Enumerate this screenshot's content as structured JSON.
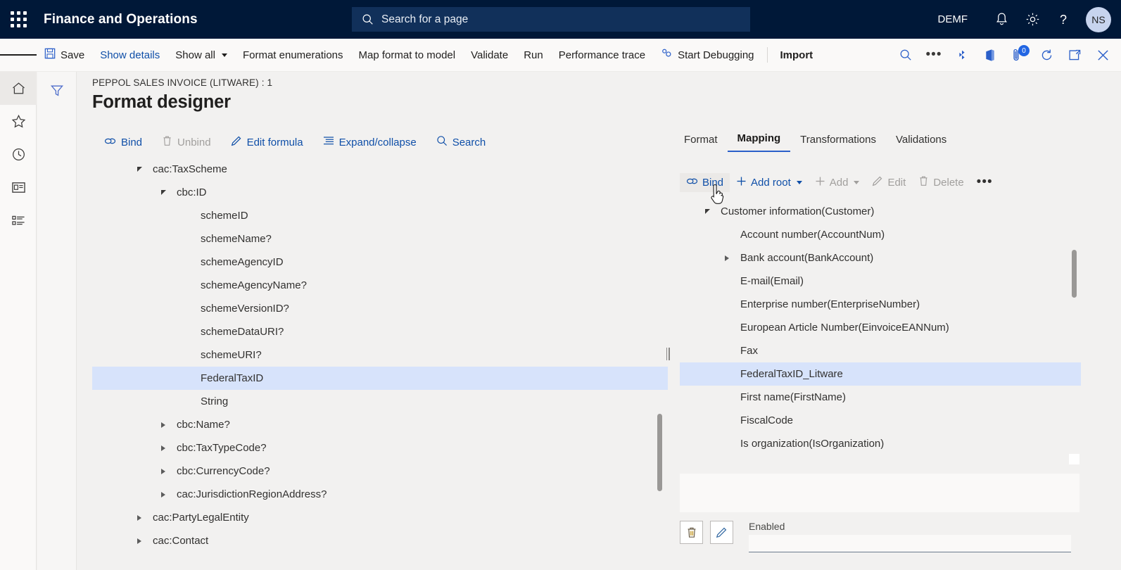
{
  "navbar": {
    "waffle_title": "app-launcher",
    "brand": "Finance and Operations",
    "search_placeholder": "Search for a page",
    "company": "DEMF",
    "notifications_icon": "bell-icon",
    "settings_icon": "gear-icon",
    "help_icon": "question-icon",
    "avatar_initials": "NS"
  },
  "commandbar": {
    "save": "Save",
    "show_details": "Show details",
    "show_all": "Show all",
    "format_enumerations": "Format enumerations",
    "map_format_to_model": "Map format to model",
    "validate": "Validate",
    "run": "Run",
    "performance_trace": "Performance trace",
    "start_debugging": "Start Debugging",
    "import": "Import",
    "icons": {
      "search": "search-icon",
      "overflow": "more-options-icon",
      "share": "share-icon",
      "office": "office-app-icon",
      "attachments": "attachments-icon",
      "attachments_count": "0",
      "refresh": "refresh-icon",
      "popout": "open-in-new-window-icon",
      "close": "close-icon"
    }
  },
  "rail": {
    "items": [
      {
        "name": "home-icon",
        "label": "Home"
      },
      {
        "name": "favorites-star-icon",
        "label": "Favorites"
      },
      {
        "name": "recent-clock-icon",
        "label": "Recent"
      },
      {
        "name": "workspaces-icon",
        "label": "Workspaces"
      },
      {
        "name": "modules-list-icon",
        "label": "Modules"
      }
    ]
  },
  "filter_panel": {
    "icon": "filter-funnel-icon"
  },
  "page": {
    "breadcrumb": "PEPPOL SALES INVOICE (LITWARE) : 1",
    "title": "Format designer"
  },
  "left_toolbar": [
    {
      "label": "Bind",
      "icon": "bind-link-icon",
      "disabled": false
    },
    {
      "label": "Unbind",
      "icon": "trash-icon",
      "disabled": true
    },
    {
      "label": "Edit formula",
      "icon": "pencil-icon",
      "disabled": false
    },
    {
      "label": "Expand/collapse",
      "icon": "list-expand-icon",
      "disabled": false
    },
    {
      "label": "Search",
      "icon": "search-icon",
      "disabled": false
    }
  ],
  "left_tree": [
    {
      "label": "cac:TaxScheme",
      "indent": 1,
      "toggle": "open",
      "selected": false
    },
    {
      "label": "cbc:ID",
      "indent": 2,
      "toggle": "open",
      "selected": false
    },
    {
      "label": "schemeID",
      "indent": 3,
      "toggle": "none",
      "selected": false
    },
    {
      "label": "schemeName?",
      "indent": 3,
      "toggle": "none",
      "selected": false
    },
    {
      "label": "schemeAgencyID",
      "indent": 3,
      "toggle": "none",
      "selected": false
    },
    {
      "label": "schemeAgencyName?",
      "indent": 3,
      "toggle": "none",
      "selected": false
    },
    {
      "label": "schemeVersionID?",
      "indent": 3,
      "toggle": "none",
      "selected": false
    },
    {
      "label": "schemeDataURI?",
      "indent": 3,
      "toggle": "none",
      "selected": false
    },
    {
      "label": "schemeURI?",
      "indent": 3,
      "toggle": "none",
      "selected": false
    },
    {
      "label": "FederalTaxID",
      "indent": 3,
      "toggle": "none",
      "selected": true
    },
    {
      "label": "String",
      "indent": 3,
      "toggle": "none",
      "selected": false
    },
    {
      "label": "cbc:Name?",
      "indent": 2,
      "toggle": "closed",
      "selected": false
    },
    {
      "label": "cbc:TaxTypeCode?",
      "indent": 2,
      "toggle": "closed",
      "selected": false
    },
    {
      "label": "cbc:CurrencyCode?",
      "indent": 2,
      "toggle": "closed",
      "selected": false
    },
    {
      "label": "cac:JurisdictionRegionAddress?",
      "indent": 2,
      "toggle": "closed",
      "selected": false
    },
    {
      "label": "cac:PartyLegalEntity",
      "indent": 1,
      "toggle": "closed",
      "selected": false
    },
    {
      "label": "cac:Contact",
      "indent": 1,
      "toggle": "closed",
      "selected": false
    }
  ],
  "right_tabs": [
    {
      "label": "Format",
      "active": false
    },
    {
      "label": "Mapping",
      "active": true
    },
    {
      "label": "Transformations",
      "active": false
    },
    {
      "label": "Validations",
      "active": false
    }
  ],
  "right_toolbar": [
    {
      "label": "Bind",
      "icon": "bind-link-icon",
      "disabled": false,
      "pressed": true,
      "caret": false
    },
    {
      "label": "Add root",
      "icon": "plus-icon",
      "disabled": false,
      "pressed": false,
      "caret": true
    },
    {
      "label": "Add",
      "icon": "plus-icon",
      "disabled": true,
      "pressed": false,
      "caret": true
    },
    {
      "label": "Edit",
      "icon": "pencil-icon",
      "disabled": true,
      "pressed": false,
      "caret": false
    },
    {
      "label": "Delete",
      "icon": "trash-icon",
      "disabled": true,
      "pressed": false,
      "caret": false
    },
    {
      "label": "…",
      "icon": "more-options-icon",
      "disabled": false,
      "pressed": false,
      "caret": false
    }
  ],
  "right_tree": [
    {
      "label": "Customer information(Customer)",
      "indent": 1,
      "toggle": "open",
      "selected": false,
      "boxed": false
    },
    {
      "label": "Account number(AccountNum)",
      "indent": 2,
      "toggle": "none",
      "selected": false,
      "boxed": false
    },
    {
      "label": "Bank account(BankAccount)",
      "indent": 2,
      "toggle": "closed",
      "selected": false,
      "boxed": false
    },
    {
      "label": "E-mail(Email)",
      "indent": 2,
      "toggle": "none",
      "selected": false,
      "boxed": false
    },
    {
      "label": "Enterprise number(EnterpriseNumber)",
      "indent": 2,
      "toggle": "none",
      "selected": false,
      "boxed": false
    },
    {
      "label": "European Article Number(EinvoiceEANNum)",
      "indent": 2,
      "toggle": "none",
      "selected": false,
      "boxed": false
    },
    {
      "label": "Fax",
      "indent": 2,
      "toggle": "none",
      "selected": false,
      "boxed": false
    },
    {
      "label": "FederalTaxID_Litware",
      "indent": 2,
      "toggle": "none",
      "selected": true,
      "boxed": true
    },
    {
      "label": "First name(FirstName)",
      "indent": 2,
      "toggle": "none",
      "selected": false,
      "boxed": false
    },
    {
      "label": "FiscalCode",
      "indent": 2,
      "toggle": "none",
      "selected": false,
      "boxed": false
    },
    {
      "label": "Is organization(IsOrganization)",
      "indent": 2,
      "toggle": "none",
      "selected": false,
      "boxed": false
    }
  ],
  "footer": {
    "delete_icon": "trash-icon",
    "edit_icon": "pencil-icon",
    "enabled_label": "Enabled",
    "enabled_value": ""
  },
  "colors": {
    "nav_background": "#001838",
    "accent_link": "#0f4fa8",
    "selection": "#d7e3fb",
    "tab_underline": "#2b5fc9",
    "page_background": "#f2f1f0"
  }
}
